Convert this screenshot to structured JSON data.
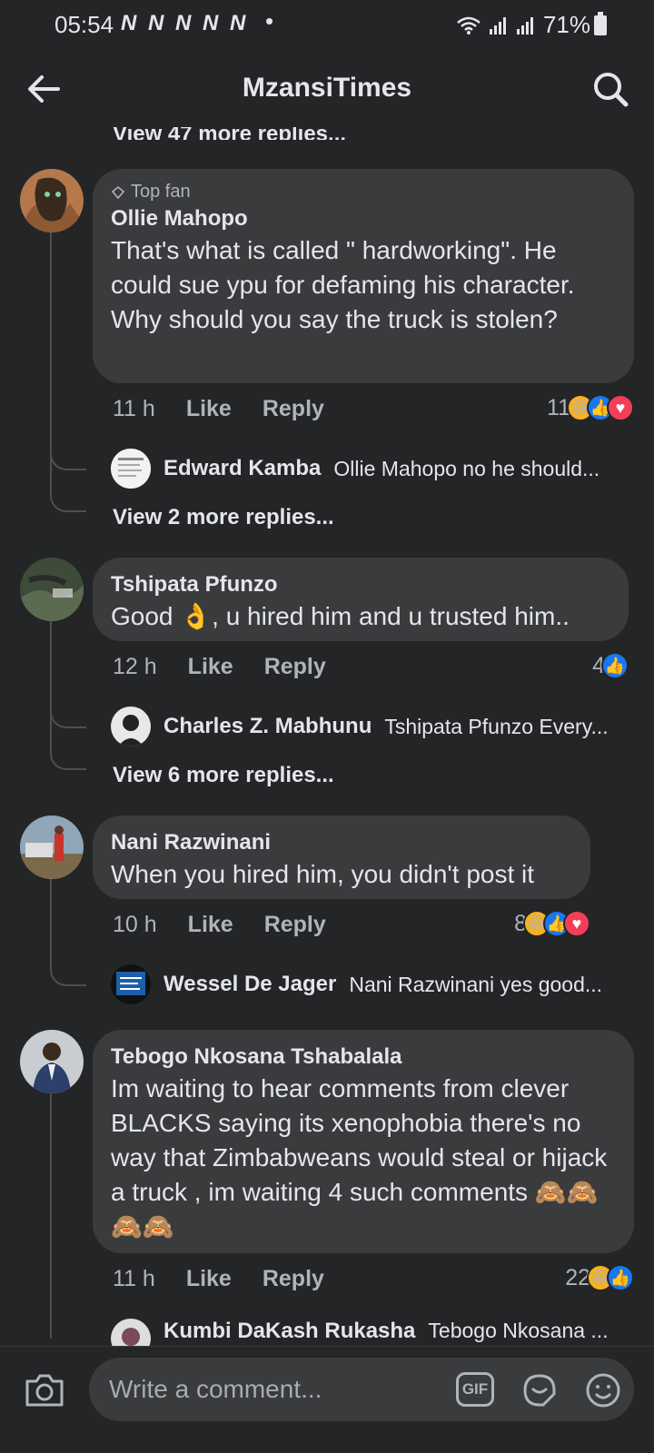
{
  "status": {
    "time": "05:54",
    "notifications": "N N N N N",
    "dot": "•",
    "battery": "71%"
  },
  "header": {
    "title": "MzansiTimes"
  },
  "cut_off_text": "View 47 more replies...",
  "comments": [
    {
      "badge": "Top fan",
      "author": "Ollie Mahopo",
      "text": "That's what is called \" hardworking\". He could sue ypu for defaming his character. Why should you say the truck is stolen?",
      "time": "11 h",
      "like": "Like",
      "reply": "Reply",
      "reaction_count": "11",
      "reactions": [
        "haha",
        "like",
        "love"
      ],
      "reply_preview": {
        "author": "Edward Kamba",
        "text": "Ollie Mahopo no he should..."
      },
      "view_more": "View 2 more replies..."
    },
    {
      "author": "Tshipata Pfunzo",
      "text": "Good 👌, u hired him and u trusted him..",
      "time": "12 h",
      "like": "Like",
      "reply": "Reply",
      "reaction_count": "4",
      "reactions": [
        "like"
      ],
      "reply_preview": {
        "author": "Charles Z. Mabhunu",
        "text": "Tshipata Pfunzo Every..."
      },
      "view_more": "View 6 more replies..."
    },
    {
      "author": "Nani Razwinani",
      "text": "When you hired him, you didn't post it",
      "time": "10 h",
      "like": "Like",
      "reply": "Reply",
      "reaction_count": "8",
      "reactions": [
        "haha",
        "like",
        "love"
      ],
      "reply_preview": {
        "author": "Wessel De Jager",
        "text": "Nani Razwinani yes good..."
      }
    },
    {
      "author": "Tebogo Nkosana Tshabalala",
      "text": "Im waiting to hear comments from clever BLACKS saying its xenophobia there's no way  that Zimbabweans would steal or hijack a truck , im waiting  4 such comments 🙈🙈🙈🙈",
      "time": "11 h",
      "like": "Like",
      "reply": "Reply",
      "reaction_count": "22",
      "reactions": [
        "haha",
        "like"
      ],
      "reply_preview": {
        "author": "Kumbi DaKash Rukasha",
        "text": "Tebogo Nkosana ..."
      }
    }
  ],
  "composer": {
    "placeholder": "Write a comment...",
    "gif_label": "GIF"
  },
  "colors": {
    "background": "#242526",
    "bubble": "#3a3b3c",
    "text": "#e4e6eb",
    "muted": "#b0b3b8",
    "like_blue": "#1877f2",
    "love_red": "#f33e58",
    "haha_yellow": "#f7b125"
  }
}
